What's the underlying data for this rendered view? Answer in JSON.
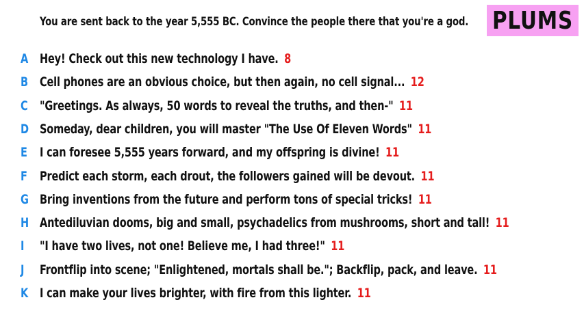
{
  "prompt": "You are sent back to the year 5,555 BC. Convince the people there that you're a god.",
  "logo": "PLUMS",
  "colors": {
    "letter": "#1e88e5",
    "score": "#e51c1c",
    "logo_bg": "#f7a1f2"
  },
  "entries": [
    {
      "letter": "A",
      "text": "Hey! Check out this new technology I have.",
      "score": "8"
    },
    {
      "letter": "B",
      "text": "Cell phones are an obvious choice, but then again, no cell signal...",
      "score": "12"
    },
    {
      "letter": "C",
      "text": "\"Greetings. As always, 50 words to reveal the truths, and then-\"",
      "score": "11"
    },
    {
      "letter": "D",
      "text": "Someday, dear children, you will master \"The Use Of Eleven Words\"",
      "score": "11"
    },
    {
      "letter": "E",
      "text": "I can foresee 5,555 years forward, and my offspring is divine!",
      "score": "11"
    },
    {
      "letter": "F",
      "text": "Predict each storm, each drout, the followers gained will be devout.",
      "score": "11"
    },
    {
      "letter": "G",
      "text": "Bring inventions from the future and perform tons of special tricks!",
      "score": "11"
    },
    {
      "letter": "H",
      "text": "Antediluvian dooms, big and small, psychadelics from mushrooms, short and tall!",
      "score": "11"
    },
    {
      "letter": "I",
      "text": "\"I have two lives, not one! Believe me, I had three!\"",
      "score": "11"
    },
    {
      "letter": "J",
      "text": "Frontflip into scene; \"Enlightened, mortals shall be.\"; Backflip, pack, and leave.",
      "score": "11"
    },
    {
      "letter": "K",
      "text": "I can make your lives brighter, with fire from this lighter.",
      "score": "11"
    }
  ]
}
